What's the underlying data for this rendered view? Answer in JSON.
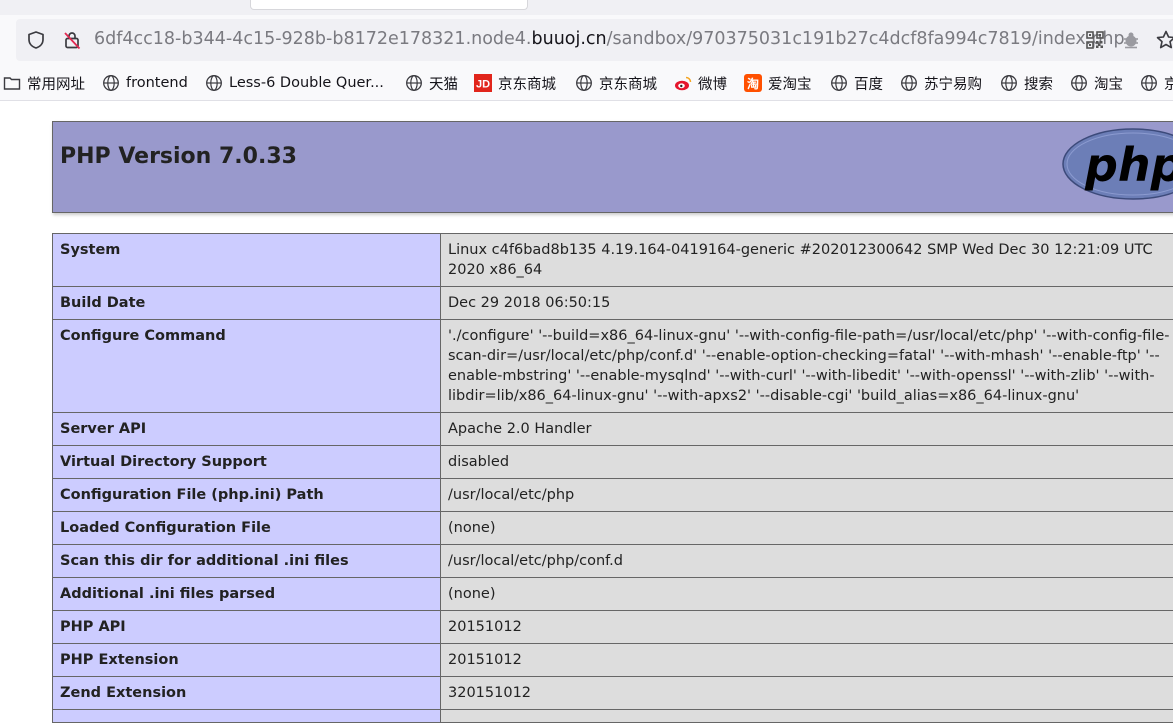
{
  "browser": {
    "url_prefix": "6df4cc18-b344-4c15-928b-b8172e178321.node4.",
    "url_domain": "buuoj.cn",
    "url_path": "/sandbox/970375031c191b27c4dcf8fa994c7819/index.php",
    "icons": [
      "shield-icon",
      "insecure-lock-icon",
      "qr-code-icon",
      "extension-icon",
      "star-icon"
    ]
  },
  "bookmarks": [
    {
      "label": "常用网址",
      "icon": "folder-icon"
    },
    {
      "label": "frontend",
      "icon": "globe-icon"
    },
    {
      "label": "Less-6 Double Quer...",
      "icon": "globe-icon"
    },
    {
      "label": "天猫",
      "icon": "globe-icon"
    },
    {
      "label": "京东商城",
      "icon": "jd-icon"
    },
    {
      "label": "京东商城",
      "icon": "globe-icon"
    },
    {
      "label": "微博",
      "icon": "weibo-icon"
    },
    {
      "label": "爱淘宝",
      "icon": "aitaobao-icon"
    },
    {
      "label": "百度",
      "icon": "globe-icon"
    },
    {
      "label": "苏宁易购",
      "icon": "globe-icon"
    },
    {
      "label": "搜索",
      "icon": "globe-icon"
    },
    {
      "label": "淘宝",
      "icon": "globe-icon"
    },
    {
      "label": "京",
      "icon": "globe-icon"
    }
  ],
  "phpinfo": {
    "title": "PHP Version 7.0.33",
    "logo_text": "php",
    "rows": [
      {
        "key": "System",
        "value": "Linux c4f6bad8b135 4.19.164-0419164-generic #202012300642 SMP Wed Dec 30 12:21:09 UTC 2020 x86_64"
      },
      {
        "key": "Build Date",
        "value": "Dec 29 2018 06:50:15"
      },
      {
        "key": "Configure Command",
        "value": "'./configure' '--build=x86_64-linux-gnu' '--with-config-file-path=/usr/local/etc/php' '--with-config-file-scan-dir=/usr/local/etc/php/conf.d' '--enable-option-checking=fatal' '--with-mhash' '--enable-ftp' '--enable-mbstring' '--enable-mysqlnd' '--with-curl' '--with-libedit' '--with-openssl' '--with-zlib' '--with-libdir=lib/x86_64-linux-gnu' '--with-apxs2' '--disable-cgi' 'build_alias=x86_64-linux-gnu'"
      },
      {
        "key": "Server API",
        "value": "Apache 2.0 Handler"
      },
      {
        "key": "Virtual Directory Support",
        "value": "disabled"
      },
      {
        "key": "Configuration File (php.ini) Path",
        "value": "/usr/local/etc/php"
      },
      {
        "key": "Loaded Configuration File",
        "value": "(none)"
      },
      {
        "key": "Scan this dir for additional .ini files",
        "value": "/usr/local/etc/php/conf.d"
      },
      {
        "key": "Additional .ini files parsed",
        "value": "(none)"
      },
      {
        "key": "PHP API",
        "value": "20151012"
      },
      {
        "key": "PHP Extension",
        "value": "20151012"
      },
      {
        "key": "Zend Extension",
        "value": "320151012"
      },
      {
        "key": "",
        "value": ""
      }
    ]
  },
  "colors": {
    "header_bg": "#9999cc",
    "key_bg": "#ccccff",
    "value_bg": "#dddddd"
  }
}
